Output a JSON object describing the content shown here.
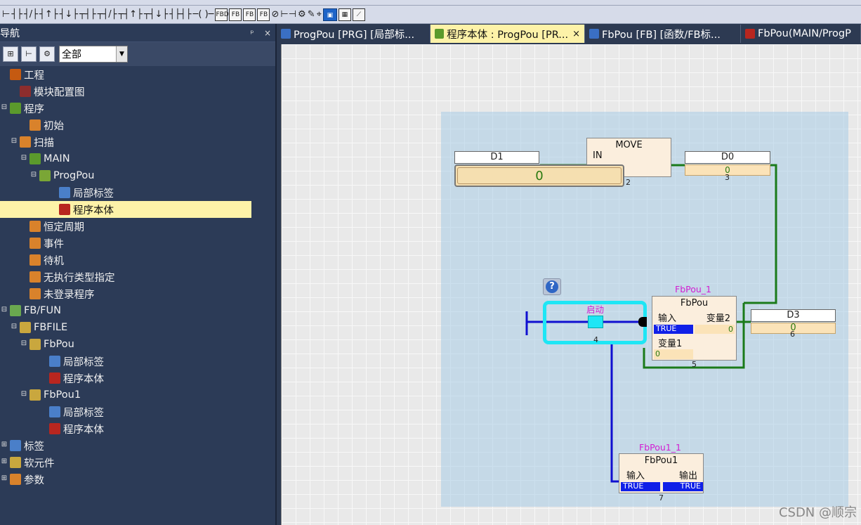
{
  "toolbar": {
    "row2_ladder_icons": [
      "contact-icon",
      "contact-icon",
      "contact-icon",
      "contact-icon",
      "contact-icon",
      "contact-icon",
      "contact-icon",
      "contact-icon",
      "contact-icon",
      "coil-icon"
    ],
    "row2_box_labels": [
      "FBD",
      "FB",
      "FB",
      "FB"
    ]
  },
  "nav": {
    "title": "导航",
    "pin": "ᵖ",
    "close": "×",
    "filter_value": "全部",
    "tree": [
      {
        "label": "工程",
        "indent": 0,
        "icon": "project-icon",
        "expand": ""
      },
      {
        "label": "模块配置图",
        "indent": 1,
        "icon": "module-config-icon",
        "expand": ""
      },
      {
        "label": "程序",
        "indent": 0,
        "icon": "program-folder-icon",
        "expand": "⊟"
      },
      {
        "label": "初始",
        "indent": 2,
        "icon": "task-icon",
        "expand": ""
      },
      {
        "label": "扫描",
        "indent": 1,
        "icon": "task-icon",
        "expand": "⊟"
      },
      {
        "label": "MAIN",
        "indent": 2,
        "icon": "main-task-icon",
        "expand": "⊟"
      },
      {
        "label": "ProgPou",
        "indent": 3,
        "icon": "pou-icon",
        "expand": "⊟"
      },
      {
        "label": "局部标签",
        "indent": 5,
        "icon": "local-label-icon",
        "expand": ""
      },
      {
        "label": "程序本体",
        "indent": 5,
        "icon": "program-body-icon",
        "expand": "",
        "selected": true
      },
      {
        "label": "恒定周期",
        "indent": 2,
        "icon": "task-icon",
        "expand": ""
      },
      {
        "label": "事件",
        "indent": 2,
        "icon": "task-icon",
        "expand": ""
      },
      {
        "label": "待机",
        "indent": 2,
        "icon": "task-icon",
        "expand": ""
      },
      {
        "label": "无执行类型指定",
        "indent": 2,
        "icon": "task-icon",
        "expand": ""
      },
      {
        "label": "未登录程序",
        "indent": 2,
        "icon": "unregistered-icon",
        "expand": ""
      },
      {
        "label": "FB/FUN",
        "indent": 0,
        "icon": "fbfun-icon",
        "expand": "⊟"
      },
      {
        "label": "FBFILE",
        "indent": 1,
        "icon": "folder-icon",
        "expand": "⊟"
      },
      {
        "label": "FbPou",
        "indent": 2,
        "icon": "folder-icon",
        "expand": "⊟"
      },
      {
        "label": "局部标签",
        "indent": 4,
        "icon": "local-label-icon",
        "expand": ""
      },
      {
        "label": "程序本体",
        "indent": 4,
        "icon": "program-body-icon",
        "expand": ""
      },
      {
        "label": "FbPou1",
        "indent": 2,
        "icon": "folder-icon",
        "expand": "⊟"
      },
      {
        "label": "局部标签",
        "indent": 4,
        "icon": "local-label-icon",
        "expand": ""
      },
      {
        "label": "程序本体",
        "indent": 4,
        "icon": "program-body-icon",
        "expand": ""
      },
      {
        "label": "标签",
        "indent": 0,
        "icon": "label-icon",
        "expand": "⊞"
      },
      {
        "label": "软元件",
        "indent": 0,
        "icon": "device-icon",
        "expand": "⊞"
      },
      {
        "label": "参数",
        "indent": 0,
        "icon": "parameter-icon",
        "expand": "⊞"
      }
    ]
  },
  "tabs": [
    {
      "label": "ProgPou [PRG] [局部标...",
      "active": false,
      "close": ""
    },
    {
      "label": "程序本体 : ProgPou [PR...",
      "active": true,
      "close": "×"
    },
    {
      "label": "FbPou [FB] [函数/FB标...",
      "active": false,
      "close": ""
    },
    {
      "label": "FbPou(MAIN/ProgP",
      "active": false,
      "close": ""
    }
  ],
  "diagram": {
    "move": {
      "title": "MOVE",
      "in_label": "IN",
      "step": "2"
    },
    "d1": {
      "name": "D1",
      "value": "0"
    },
    "d0": {
      "name": "D0",
      "value": "0",
      "step": "3"
    },
    "help": "?",
    "contact": {
      "label": "启动",
      "step": "4"
    },
    "fbpou_1": {
      "instance": "FbPou_1",
      "type": "FbPou",
      "in_label": "输入",
      "out_label": "变量2",
      "in_value": "TRUE",
      "out_value": "0",
      "var_label": "变量1",
      "var_value": "0",
      "step": "5"
    },
    "d3": {
      "name": "D3",
      "value": "0",
      "step": "6"
    },
    "fbpou1_1": {
      "instance": "FbPou1_1",
      "type": "FbPou1",
      "in_label": "输入",
      "out_label": "输出",
      "in_value": "TRUE",
      "out_value": "TRUE",
      "step": "7"
    }
  },
  "watermark": "CSDN @顺宗"
}
